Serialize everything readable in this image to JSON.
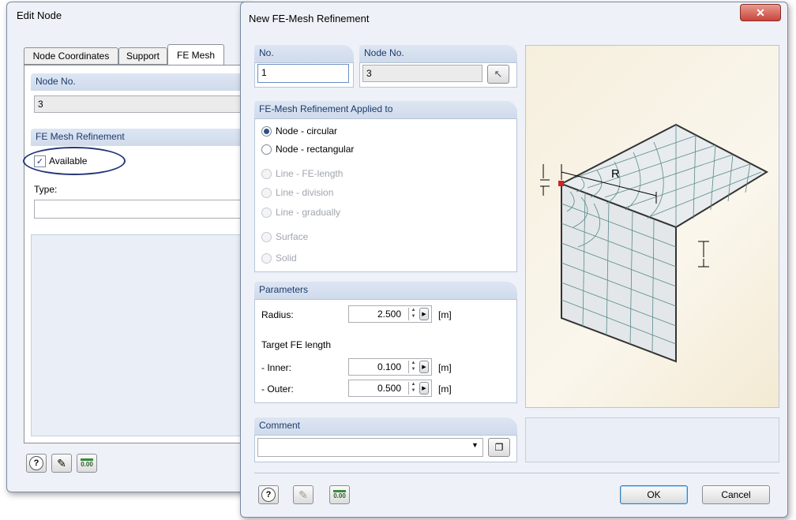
{
  "edit_node": {
    "title": "Edit Node",
    "tabs": [
      "Node Coordinates",
      "Support",
      "FE Mesh"
    ],
    "node_no_label": "Node No.",
    "node_no_value": "3",
    "refinement_label": "FE Mesh Refinement",
    "available_label": "Available",
    "available_checked": true,
    "type_label": "Type:",
    "type_value": "",
    "footer_value_icon_text": "0.00"
  },
  "dialog": {
    "title": "New FE-Mesh Refinement",
    "no_label": "No.",
    "no_value": "1",
    "node_no_label": "Node No.",
    "node_no_value": "3",
    "applied_label": "FE-Mesh Refinement Applied to",
    "options": [
      {
        "label": "Node - circular",
        "selected": true,
        "enabled": true
      },
      {
        "label": "Node - rectangular",
        "selected": false,
        "enabled": true
      },
      {
        "label": "Line - FE-length",
        "selected": false,
        "enabled": false
      },
      {
        "label": "Line - division",
        "selected": false,
        "enabled": false
      },
      {
        "label": "Line - gradually",
        "selected": false,
        "enabled": false
      },
      {
        "label": "Surface",
        "selected": false,
        "enabled": false
      },
      {
        "label": "Solid",
        "selected": false,
        "enabled": false
      }
    ],
    "parameters_label": "Parameters",
    "radius_label": "Radius:",
    "radius_value": "2.500",
    "radius_unit": "[m]",
    "target_label": "Target FE length",
    "inner_label": "- Inner:",
    "inner_value": "0.100",
    "inner_unit": "[m]",
    "outer_label": "- Outer:",
    "outer_value": "0.500",
    "outer_unit": "[m]",
    "comment_label": "Comment",
    "comment_value": "",
    "diagram_label": "R",
    "footer_value_icon_text": "0.00",
    "ok_label": "OK",
    "cancel_label": "Cancel"
  },
  "colors": {
    "accent_header": "#1d3a6b",
    "close_button": "#c9463d",
    "selected_node": "#d42020",
    "mesh_lines": "#5a8a8a"
  }
}
